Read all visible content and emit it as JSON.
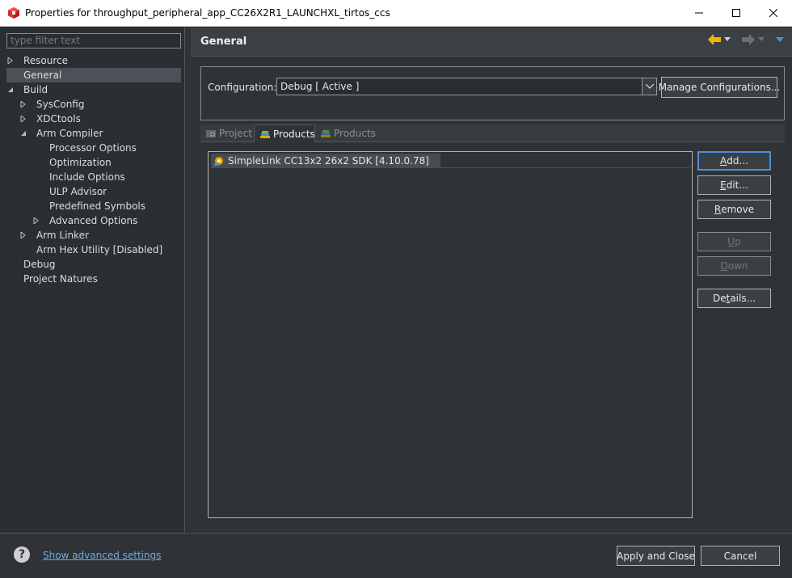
{
  "window": {
    "title": "Properties for throughput_peripheral_app_CC26X2R1_LAUNCHXL_tirtos_ccs",
    "app_icon": "ti-cube-icon",
    "minimize_icon": "minimize-icon",
    "maximize_icon": "maximize-icon",
    "close_icon": "close-icon"
  },
  "left": {
    "filter_placeholder": "type filter text",
    "tree": [
      {
        "label": "Resource",
        "level": 0,
        "twisty": "collapsed"
      },
      {
        "label": "General",
        "level": 0,
        "twisty": "none",
        "selected": true
      },
      {
        "label": "Build",
        "level": 0,
        "twisty": "expanded"
      },
      {
        "label": "SysConfig",
        "level": 1,
        "twisty": "collapsed"
      },
      {
        "label": "XDCtools",
        "level": 1,
        "twisty": "collapsed"
      },
      {
        "label": "Arm Compiler",
        "level": 1,
        "twisty": "expanded"
      },
      {
        "label": "Processor Options",
        "level": 2,
        "twisty": "none"
      },
      {
        "label": "Optimization",
        "level": 2,
        "twisty": "none"
      },
      {
        "label": "Include Options",
        "level": 2,
        "twisty": "none"
      },
      {
        "label": "ULP Advisor",
        "level": 2,
        "twisty": "none"
      },
      {
        "label": "Predefined Symbols",
        "level": 2,
        "twisty": "none"
      },
      {
        "label": "Advanced Options",
        "level": 2,
        "twisty": "collapsed"
      },
      {
        "label": "Arm Linker",
        "level": 1,
        "twisty": "collapsed"
      },
      {
        "label": "Arm Hex Utility  [Disabled]",
        "level": 1,
        "twisty": "none"
      },
      {
        "label": "Debug",
        "level": 0,
        "twisty": "none"
      },
      {
        "label": "Project Natures",
        "level": 0,
        "twisty": "none"
      }
    ]
  },
  "right": {
    "title": "General",
    "config_label": "Configuration:",
    "config_value": "Debug  [ Active ]",
    "manage_button": "Manage Configurations...",
    "tabs": [
      {
        "label": "Project",
        "active": false
      },
      {
        "label": "Products",
        "active": true
      },
      {
        "label": "Products",
        "active": false
      }
    ],
    "products": [
      {
        "label": "SimpleLink CC13x2 26x2 SDK  [4.10.0.78]"
      }
    ],
    "buttons": {
      "add": {
        "pre": "",
        "mnemonic": "A",
        "post": "dd..."
      },
      "edit": {
        "pre": "",
        "mnemonic": "E",
        "post": "dit..."
      },
      "remove": {
        "pre": "",
        "mnemonic": "R",
        "post": "emove"
      },
      "up": {
        "pre": "",
        "mnemonic": "U",
        "post": "p"
      },
      "down": {
        "pre": "",
        "mnemonic": "D",
        "post": "own"
      },
      "details": {
        "pre": "De",
        "mnemonic": "t",
        "post": "ails..."
      }
    }
  },
  "bottom": {
    "help_glyph": "?",
    "advanced_link": "Show advanced settings",
    "apply_close": "Apply and Close",
    "cancel": "Cancel"
  },
  "colors": {
    "accent": "#4d90d6",
    "link": "#6fa8dc",
    "nav_arrow": "#f2b600"
  }
}
